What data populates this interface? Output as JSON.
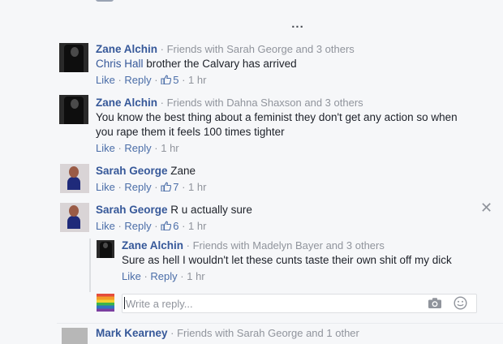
{
  "more_indicator": "...",
  "comments": [
    {
      "author": "Zane Alchin",
      "meta": " · Friends with Sarah George and 3 others",
      "mention": "Chris Hall",
      "text": " brother the Calvary has arrived",
      "actions": {
        "like": "Like",
        "reply": "Reply",
        "likes": "5",
        "time": "1 hr"
      },
      "avatar": "dark-silhouette-avatar"
    },
    {
      "author": "Zane Alchin",
      "meta": " · Friends with Dahna Shaxson and 3 others",
      "text_line1": "You know the best thing about a feminist they don't get any action so when",
      "text_line2": "you rape them it feels 100 times tighter",
      "actions": {
        "like": "Like",
        "reply": "Reply",
        "time": "1 hr"
      },
      "avatar": "dark-silhouette-avatar"
    },
    {
      "author": "Sarah George",
      "text": " Zane",
      "actions": {
        "like": "Like",
        "reply": "Reply",
        "likes": "7",
        "time": "1 hr"
      },
      "avatar": "woman-portrait-avatar"
    },
    {
      "author": "Sarah George",
      "text": " R u actually sure",
      "actions": {
        "like": "Like",
        "reply": "Reply",
        "likes": "6",
        "time": "1 hr"
      },
      "avatar": "woman-portrait-avatar"
    }
  ],
  "reply": {
    "author": "Zane Alchin",
    "meta": " · Friends with Madelyn Bayer and 3 others",
    "text": "Sure as hell I wouldn't let these cunts taste their own shit off my dick",
    "actions": {
      "like": "Like",
      "reply": "Reply",
      "time": "1 hr"
    }
  },
  "reply_input": {
    "placeholder": "Write a reply...",
    "value": ""
  },
  "next_comment": {
    "author": "Mark Kearney",
    "meta": " · Friends with Sarah George and 1 other"
  },
  "icons": {
    "like": "thumbs-up-icon",
    "camera": "camera-icon",
    "emoji": "smiley-icon",
    "close": "close-icon"
  },
  "colors": {
    "link": "#365899",
    "action_link": "#4b6ea8",
    "meta": "#90949c",
    "background": "#f6f7f9"
  }
}
